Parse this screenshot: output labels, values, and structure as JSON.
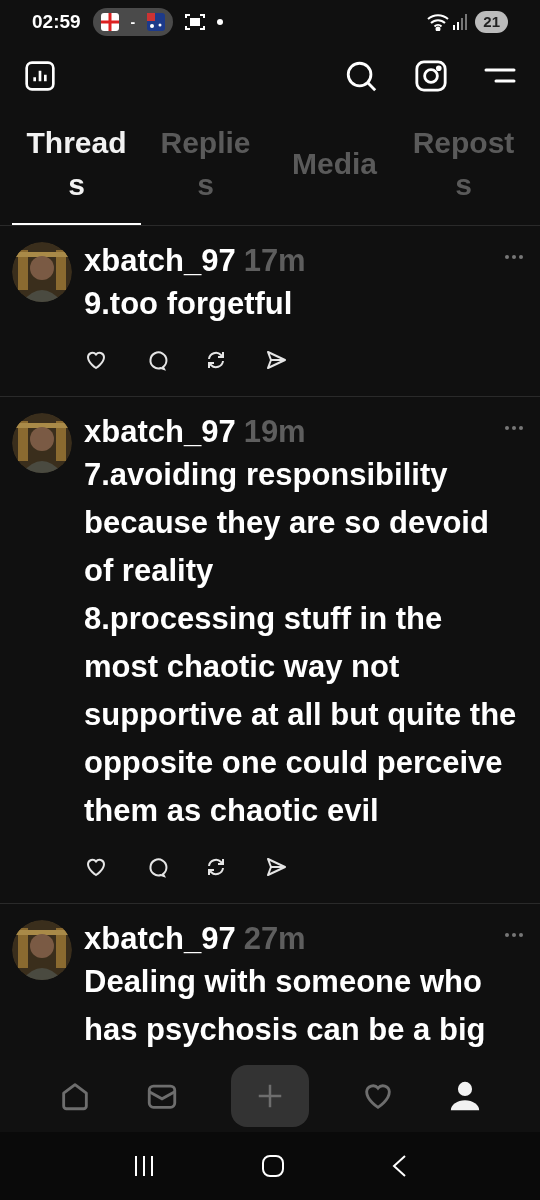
{
  "status_bar": {
    "time": "02:59",
    "score_separator": "-",
    "battery": "21"
  },
  "tabs": [
    {
      "label": "Threads",
      "selected": true
    },
    {
      "label": "Replies",
      "selected": false
    },
    {
      "label": "Media",
      "selected": false
    },
    {
      "label": "Reposts",
      "selected": false
    }
  ],
  "posts": [
    {
      "username": "xbatch_97",
      "time": "17m",
      "lines": [
        "9.too forgetful"
      ]
    },
    {
      "username": "xbatch_97",
      "time": "19m",
      "lines": [
        "7.avoiding responsibility because they are so devoid of reality",
        "8.processing stuff in the most chaotic way not supportive at all but quite the opposite one could perceive them as chaotic evil"
      ]
    },
    {
      "username": "xbatch_97",
      "time": "27m",
      "lines": [
        "Dealing with someone who has psychosis can be a big"
      ]
    }
  ],
  "bottom_nav": [
    {
      "kind": "home",
      "selected": false
    },
    {
      "kind": "inbox",
      "selected": false
    },
    {
      "kind": "compose",
      "selected": false
    },
    {
      "kind": "activity",
      "selected": false
    },
    {
      "kind": "profile",
      "selected": true
    }
  ]
}
